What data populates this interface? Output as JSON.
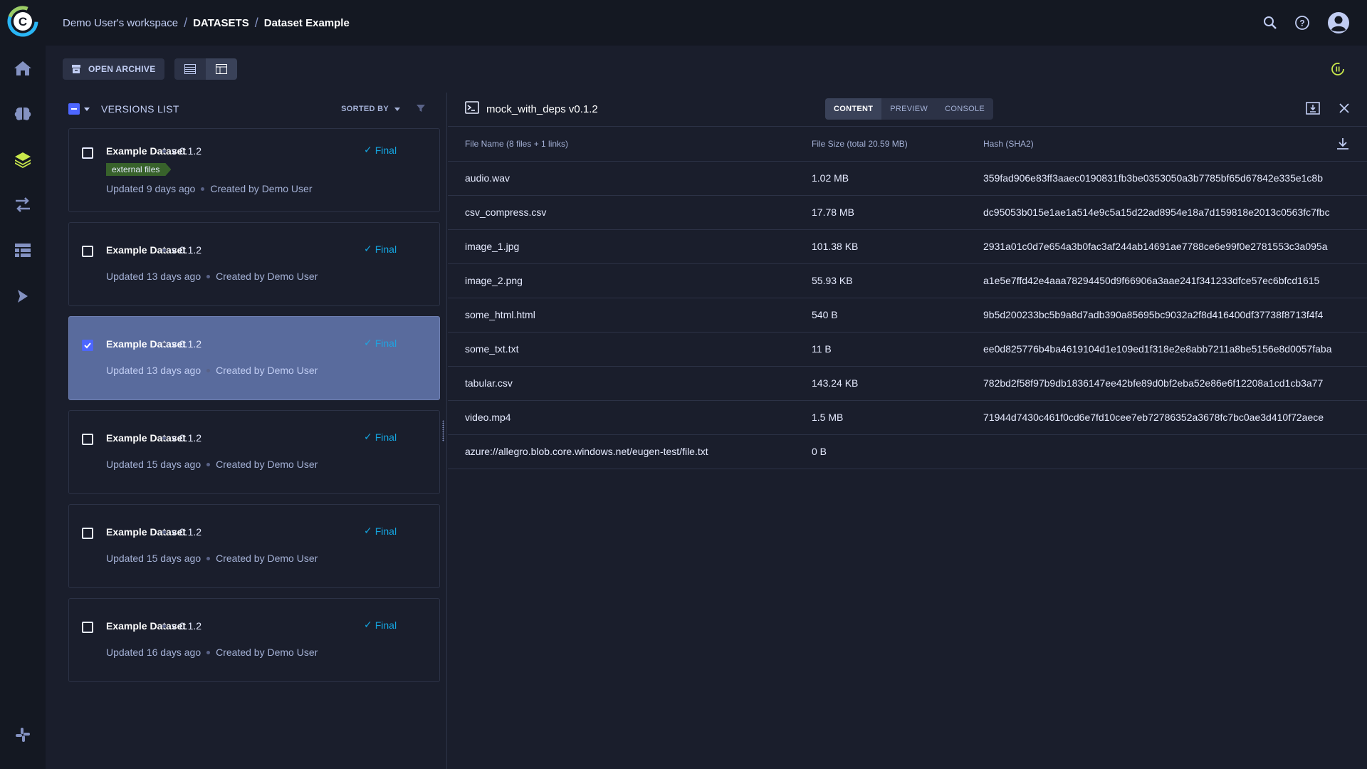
{
  "breadcrumb": {
    "workspace": "Demo User's workspace",
    "section": "DATASETS",
    "page": "Dataset Example"
  },
  "toolbar": {
    "open_archive_label": "OPEN ARCHIVE"
  },
  "versions": {
    "title": "VERSIONS LIST",
    "sorted_by_label": "SORTED BY",
    "cards": [
      {
        "title": "Example Dataset",
        "version": "v 0.1.2",
        "status": "Final",
        "tag": "external files",
        "updated": "Updated 9 days ago",
        "creator": "Created by Demo User",
        "checked": false
      },
      {
        "title": "Example Dataset",
        "version": "v 0.1.2",
        "status": "Final",
        "tag": "",
        "updated": "Updated 13 days ago",
        "creator": "Created by Demo User",
        "checked": false
      },
      {
        "title": "Example Dataset",
        "version": "v 0.1.2",
        "status": "Final",
        "tag": "",
        "updated": "Updated 13 days ago",
        "creator": "Created by Demo User",
        "checked": true
      },
      {
        "title": "Example Dataset",
        "version": "v 0.1.2",
        "status": "Final",
        "tag": "",
        "updated": "Updated 15 days ago",
        "creator": "Created by Demo User",
        "checked": false
      },
      {
        "title": "Example Dataset",
        "version": "v 0.1.2",
        "status": "Final",
        "tag": "",
        "updated": "Updated 15 days ago",
        "creator": "Created by Demo User",
        "checked": false
      },
      {
        "title": "Example Dataset",
        "version": "v 0.1.2",
        "status": "Final",
        "tag": "",
        "updated": "Updated 16 days ago",
        "creator": "Created by Demo User",
        "checked": false
      }
    ]
  },
  "details": {
    "title": "mock_with_deps v0.1.2",
    "tabs": [
      "CONTENT",
      "PREVIEW",
      "CONSOLE"
    ],
    "active_tab": "CONTENT",
    "columns": [
      "File Name (8 files + 1 links)",
      "File Size (total 20.59 MB)",
      "Hash (SHA2)"
    ],
    "files": [
      {
        "name": "audio.wav",
        "size": "1.02 MB",
        "hash": "359fad906e83ff3aaec0190831fb3be0353050a3b7785bf65d67842e335e1c8b"
      },
      {
        "name": "csv_compress.csv",
        "size": "17.78 MB",
        "hash": "dc95053b015e1ae1a514e9c5a15d22ad8954e18a7d159818e2013c0563fc7fbc"
      },
      {
        "name": "image_1.jpg",
        "size": "101.38 KB",
        "hash": "2931a01c0d7e654a3b0fac3af244ab14691ae7788ce6e99f0e2781553c3a095a"
      },
      {
        "name": "image_2.png",
        "size": "55.93 KB",
        "hash": "a1e5e7ffd42e4aaa78294450d9f66906a3aae241f341233dfce57ec6bfcd1615"
      },
      {
        "name": "some_html.html",
        "size": "540 B",
        "hash": "9b5d200233bc5b9a8d7adb390a85695bc9032a2f8d416400df37738f8713f4f4"
      },
      {
        "name": "some_txt.txt",
        "size": "11 B",
        "hash": "ee0d825776b4ba4619104d1e109ed1f318e2e8abb7211a8be5156e8d0057faba"
      },
      {
        "name": "tabular.csv",
        "size": "143.24 KB",
        "hash": "782bd2f58f97b9db1836147ee42bfe89d0bf2eba52e86e6f12208a1cd1cb3a77"
      },
      {
        "name": "video.mp4",
        "size": "1.5 MB",
        "hash": "71944d7430c461f0cd6e7fd10cee7eb72786352a3678fc7bc0ae3d410f72aece"
      },
      {
        "name": "azure://allegro.blob.core.windows.net/eugen-test/file.txt",
        "size": "0 B",
        "hash": ""
      }
    ]
  },
  "colors": {
    "accent": "#4d66ff",
    "final": "#14a5e0",
    "tag_bg": "#38622b",
    "selected_card": "#596b9d"
  },
  "icons": {
    "nav": [
      "home-icon",
      "brain-icon",
      "layers-icon",
      "pipelines-icon",
      "table-icon",
      "deploy-icon"
    ],
    "bottom": "slack-icon"
  }
}
